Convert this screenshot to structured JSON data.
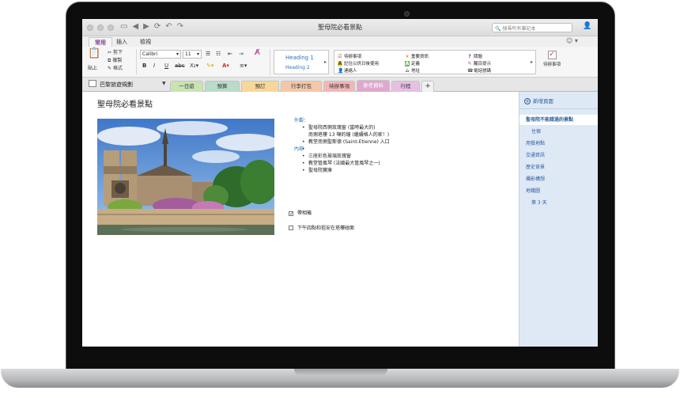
{
  "window": {
    "title": "聖母院必看景點",
    "search_placeholder": "搜尋所有筆記本"
  },
  "ribbon_tabs": [
    "常用",
    "插入",
    "檢視"
  ],
  "clipboard": {
    "paste": "貼上",
    "cut": "剪下",
    "copy": "複製",
    "format": "格式"
  },
  "font": {
    "name": "Calibri",
    "size": "11"
  },
  "styles": [
    "Heading 1",
    "Heading 2"
  ],
  "tags": [
    {
      "icon": "checkbox-icon",
      "label": "待辦事項"
    },
    {
      "icon": "star-icon",
      "label": "重要資訊"
    },
    {
      "icon": "question-icon",
      "label": "問題"
    },
    {
      "icon": "highlight-icon",
      "label": "記住以供日後使用"
    },
    {
      "icon": "definition-icon",
      "label": "定義"
    },
    {
      "icon": "pen-icon",
      "label": "醒目提示"
    },
    {
      "icon": "contact-icon",
      "label": "連絡人"
    },
    {
      "icon": "address-icon",
      "label": "地址"
    },
    {
      "icon": "phone-icon",
      "label": "電話號碼"
    }
  ],
  "todo_tag": "待辦事項",
  "notebook": "巴黎旅遊規劃",
  "sections": [
    {
      "label": "一日遊",
      "color": "#c9e3b2"
    },
    {
      "label": "預算",
      "color": "#b8dcc8"
    },
    {
      "label": "預訂",
      "color": "#f7d79a"
    },
    {
      "label": "行李打包",
      "color": "#f5c7a9"
    },
    {
      "label": "待辦事項",
      "color": "#f2b7b5"
    },
    {
      "label": "參考資料",
      "color": "#e0a8cf"
    },
    {
      "label": "行程",
      "color": "#e5c0e3"
    },
    {
      "label": "+",
      "color": "#f2f2f2"
    }
  ],
  "page": {
    "title": "聖母院必看景點",
    "exterior_heading": "外觀：",
    "exterior_items": [
      "聖母院西側玫瑰窗 (當時最大的)",
      "南側塔樓 13 噸的鐘 (繼續格人的家！)",
      "教堂南側聖斯德 (Saint-Etienne) 入口",
      ""
    ],
    "exterior_cont": "南側塔樓 13 噸的鐘 (繼續格人的家！)",
    "interior_heading": "內部",
    "interior_items": [
      "三座彩色玻璃玫瑰窗",
      "教堂管風琴 (法國最大管風琴之一)",
      "聖母院寶庫"
    ],
    "checkboxes": [
      {
        "label": "帶相機",
        "checked": true
      },
      {
        "label": "下午四點和祖安在塔樓碰面",
        "checked": false
      }
    ]
  },
  "pages_pane": {
    "add_page": "新增頁面",
    "items": [
      "聖母院不能錯過的景點",
      "住宿",
      "用餐地點",
      "交通資訊",
      "歷史背景",
      "攝影構想",
      "地鐵圖",
      "第 3 天"
    ]
  }
}
